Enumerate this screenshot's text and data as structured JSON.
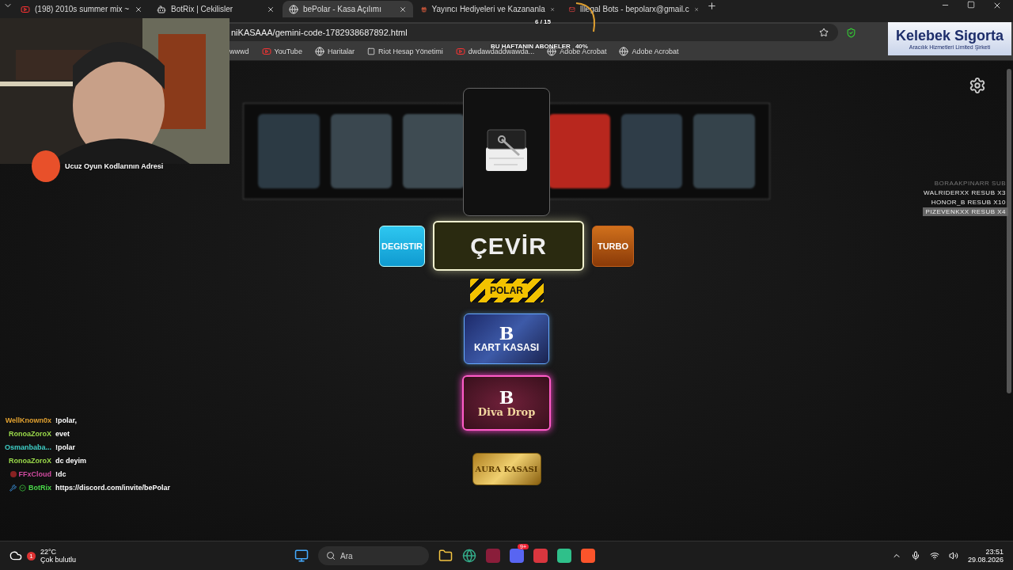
{
  "tabs": [
    {
      "title": "(198) 2010s summer mix ~",
      "kind": "video",
      "selected": false
    },
    {
      "title": "BotRix | Cekilisler",
      "kind": "bot",
      "selected": false
    },
    {
      "title": "bePolar - Kasa Açılımı",
      "kind": "globe",
      "selected": true
    },
    {
      "title": "Yayıncı Hediyeleri ve Kazananla",
      "kind": "gift",
      "selected": false
    },
    {
      "title": "Illegal Bots - bepolarx@gmail.c",
      "kind": "mail",
      "selected": false
    }
  ],
  "address": {
    "url": "niKASAAA/gemini-code-1782938687892.html"
  },
  "bookmarks": [
    {
      "label": "wwwd",
      "kind": "none"
    },
    {
      "label": "YouTube",
      "kind": "video"
    },
    {
      "label": "Haritalar",
      "kind": "globe"
    },
    {
      "label": "Riot Hesap Yönetimi",
      "kind": "riot"
    },
    {
      "label": "dwdawdaddwawda...",
      "kind": "video"
    },
    {
      "label": "Adobe Acrobat",
      "kind": "globe"
    },
    {
      "label": "Adobe Acrobat",
      "kind": "globe"
    }
  ],
  "game": {
    "buttons": [
      {
        "label": "DEGISTIR",
        "kind": "side-blue"
      },
      {
        "label": "ÇEVİR",
        "kind": "main"
      },
      {
        "label": "TURBO",
        "kind": "side-orange"
      }
    ],
    "polar_label": "POLAR",
    "cases": [
      {
        "label": "KART KASASI",
        "letter": "B",
        "kind": "kart"
      },
      {
        "label": "Diva Drop",
        "letter": "B",
        "kind": "diva"
      },
      {
        "label": "AURA KASASI",
        "kind": "aura"
      }
    ]
  },
  "overlay": {
    "brand": "Ucuz Oyun Kodlarının Adresi",
    "goal_title": "BU HAFTANIN ABONELER",
    "goal_count": "6 / 15",
    "goal_percent": "40%",
    "sponsor": {
      "name": "Kelebek Sigorta",
      "tagline": "Aracılık Hizmetleri Limited Şirketi"
    },
    "subs": [
      {
        "text": "BORAAKPINARR SUB",
        "faded": true,
        "selected": false
      },
      {
        "text": "WALRIDERXX RESUB X3",
        "faded": false,
        "selected": false
      },
      {
        "text": "HONOR_B RESUB X10",
        "faded": false,
        "selected": false
      },
      {
        "text": "PIZEVENKXX RESUB X4",
        "faded": false,
        "selected": true
      }
    ],
    "chat": [
      {
        "user": "WellKnown0x",
        "message": "!polar,",
        "color": "#e0a030",
        "avatar": false,
        "moderator": false,
        "verified": false
      },
      {
        "user": "RonoaZoroX",
        "message": "evet",
        "color": "#9ad94a",
        "avatar": false,
        "moderator": false,
        "verified": false
      },
      {
        "user": "Osmanbaba...",
        "message": "!polar",
        "color": "#3fd0c8",
        "avatar": false,
        "moderator": false,
        "verified": false
      },
      {
        "user": "RonoaZoroX",
        "message": "dc deyim",
        "color": "#9ad94a",
        "avatar": false,
        "moderator": false,
        "verified": false
      },
      {
        "user": "FFxCloud",
        "message": "!dc",
        "color": "#d04aa0",
        "avatar": true,
        "moderator": false,
        "verified": false
      },
      {
        "user": "BotRix",
        "message": "https://discord.com/invite/bePolar",
        "color": "#4ad94a",
        "avatar": false,
        "moderator": true,
        "verified": true
      }
    ]
  },
  "taskbar": {
    "temperature": "22°C",
    "weather": "Çok bulutlu",
    "weather_badge": "1",
    "search_placeholder": "Ara",
    "discord_badge": "9+",
    "time": "23:51",
    "date": "29.08.2026"
  }
}
